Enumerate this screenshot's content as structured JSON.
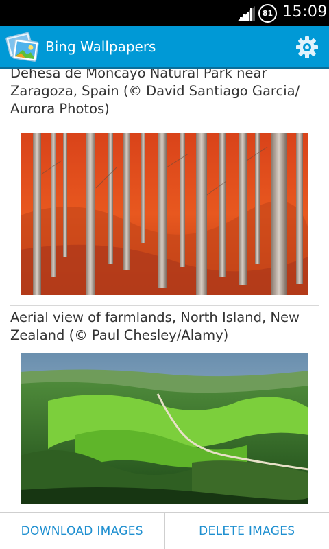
{
  "status_bar": {
    "battery": "81",
    "time": "15:09"
  },
  "action_bar": {
    "title": "Bing Wallpapers",
    "app_icon": "pictures-icon",
    "settings_icon": "gear-icon",
    "accent_color": "#0099d6"
  },
  "wallpapers": [
    {
      "caption": "Dehesa de Moncayo Natural Park near Zaragoza, Spain (© David Santiago Garcia/ Aurora Photos)",
      "image_subject": "autumn beech forest"
    },
    {
      "caption": "Aerial view of farmlands, North Island, New Zealand (© Paul Chesley/Alamy)",
      "image_subject": "aerial green hills"
    }
  ],
  "actions": {
    "download_label": "DOWNLOAD IMAGES",
    "delete_label": "DELETE IMAGES",
    "button_color": "#1e8fd0"
  }
}
